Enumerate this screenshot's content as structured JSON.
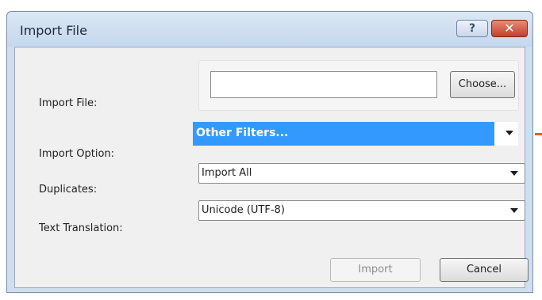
{
  "dialog": {
    "title": "Import File",
    "help_label": "?",
    "close_label": "✕"
  },
  "form": {
    "import_file": {
      "label": "Import File:",
      "value": "",
      "choose_label": "Choose..."
    },
    "import_option": {
      "label": "Import Option:",
      "selected": "Other Filters..."
    },
    "duplicates": {
      "label": "Duplicates:",
      "selected": "Import All"
    },
    "text_translation": {
      "label": "Text Translation:",
      "selected": "Unicode (UTF-8)"
    }
  },
  "buttons": {
    "import_label": "Import",
    "cancel_label": "Cancel"
  },
  "colors": {
    "selection": "#3399ff",
    "close_button": "#c2412a"
  }
}
